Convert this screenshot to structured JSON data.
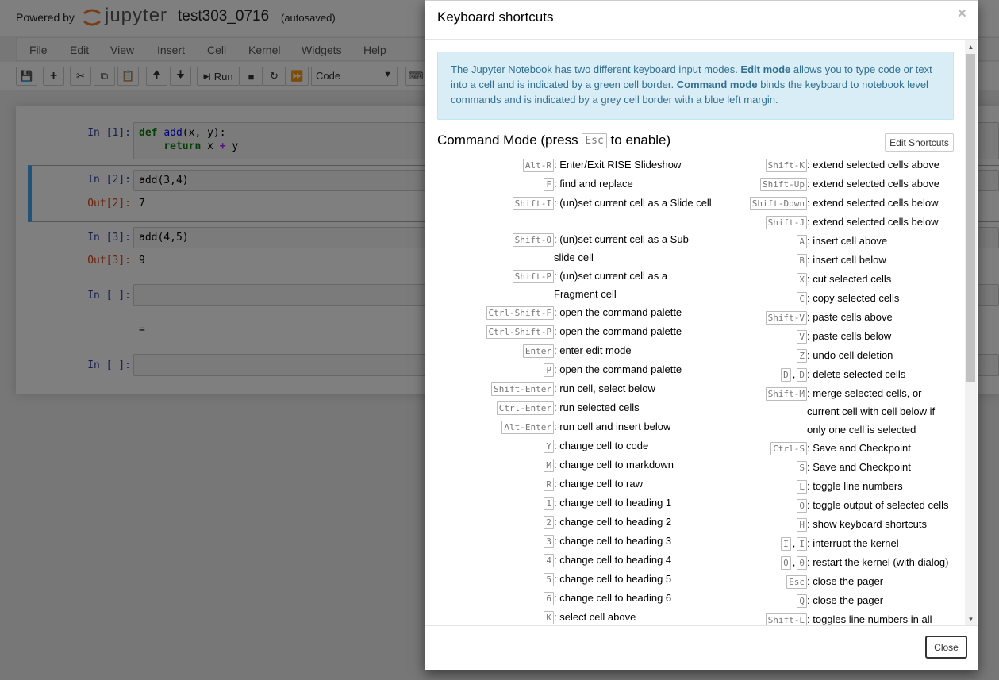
{
  "header": {
    "powered_by": "Powered by",
    "logo_text": "jupyter",
    "notebook_title": "test303_0716",
    "autosave_status": "(autosaved)"
  },
  "menu": [
    "File",
    "Edit",
    "View",
    "Insert",
    "Cell",
    "Kernel",
    "Widgets",
    "Help"
  ],
  "toolbar": {
    "run_label": "Run",
    "cell_type": "Code"
  },
  "cells": [
    {
      "in_prompt": "In [1]:",
      "line1_kw": "def",
      "line1_fn": "add",
      "line1_rest": "(x, y):",
      "line2_kw": "return",
      "line2_a": " x ",
      "line2_op": "+",
      "line2_b": " y"
    },
    {
      "in_prompt": "In [2]:",
      "code": "add(3,4)",
      "out_prompt": "Out[2]:",
      "output": "7"
    },
    {
      "in_prompt": "In [3]:",
      "code": "add(4,5)",
      "out_prompt": "Out[3]:",
      "output": "9"
    },
    {
      "in_prompt": "In [ ]:",
      "output": "="
    },
    {
      "in_prompt": "In [ ]:"
    }
  ],
  "modal": {
    "title": "Keyboard shortcuts",
    "close_x": "×",
    "info": {
      "t1": "The Jupyter Notebook has two different keyboard input modes. ",
      "b1": "Edit mode",
      "t2": " allows you to type code or text into a cell and is indicated by a green cell border. ",
      "b2": "Command mode",
      "t3": " binds the keyboard to notebook level commands and is indicated by a grey cell border with a blue left margin."
    },
    "section_pre": "Command Mode (press ",
    "section_key": "Esc",
    "section_post": " to enable)",
    "edit_shortcuts": "Edit Shortcuts",
    "close_button": "Close",
    "left_shortcuts": [
      {
        "keys": [
          "Alt-R"
        ],
        "desc": ": Enter/Exit RISE Slideshow"
      },
      {
        "keys": [
          "F"
        ],
        "desc": ": find and replace"
      },
      {
        "keys": [
          "Shift-I"
        ],
        "desc": ": (un)set current cell as a Slide cell"
      },
      {
        "keys": [
          "Shift-O"
        ],
        "desc": ": (un)set current cell as a Sub-slide cell"
      },
      {
        "keys": [
          "Shift-P"
        ],
        "desc": ": (un)set current cell as a Fragment cell"
      },
      {
        "keys": [
          "Ctrl-Shift-F"
        ],
        "desc": ": open the command palette"
      },
      {
        "keys": [
          "Ctrl-Shift-P"
        ],
        "desc": ": open the command palette"
      },
      {
        "keys": [
          "Enter"
        ],
        "desc": ": enter edit mode"
      },
      {
        "keys": [
          "P"
        ],
        "desc": ": open the command palette"
      },
      {
        "keys": [
          "Shift-Enter"
        ],
        "desc": ": run cell, select below"
      },
      {
        "keys": [
          "Ctrl-Enter"
        ],
        "desc": ": run selected cells"
      },
      {
        "keys": [
          "Alt-Enter"
        ],
        "desc": ": run cell and insert below"
      },
      {
        "keys": [
          "Y"
        ],
        "desc": ": change cell to code"
      },
      {
        "keys": [
          "M"
        ],
        "desc": ": change cell to markdown"
      },
      {
        "keys": [
          "R"
        ],
        "desc": ": change cell to raw"
      },
      {
        "keys": [
          "1"
        ],
        "desc": ": change cell to heading 1"
      },
      {
        "keys": [
          "2"
        ],
        "desc": ": change cell to heading 2"
      },
      {
        "keys": [
          "3"
        ],
        "desc": ": change cell to heading 3"
      },
      {
        "keys": [
          "4"
        ],
        "desc": ": change cell to heading 4"
      },
      {
        "keys": [
          "5"
        ],
        "desc": ": change cell to heading 5"
      },
      {
        "keys": [
          "6"
        ],
        "desc": ": change cell to heading 6"
      },
      {
        "keys": [
          "K"
        ],
        "desc": ": select cell above"
      }
    ],
    "right_shortcuts": [
      {
        "keys": [
          "Shift-K"
        ],
        "desc": ": extend selected cells above"
      },
      {
        "keys": [
          "Shift-Up"
        ],
        "desc": ": extend selected cells above"
      },
      {
        "keys": [
          "Shift-Down"
        ],
        "desc": ": extend selected cells below"
      },
      {
        "keys": [
          "Shift-J"
        ],
        "desc": ": extend selected cells below"
      },
      {
        "keys": [
          "A"
        ],
        "desc": ": insert cell above"
      },
      {
        "keys": [
          "B"
        ],
        "desc": ": insert cell below"
      },
      {
        "keys": [
          "X"
        ],
        "desc": ": cut selected cells"
      },
      {
        "keys": [
          "C"
        ],
        "desc": ": copy selected cells"
      },
      {
        "keys": [
          "Shift-V"
        ],
        "desc": ": paste cells above"
      },
      {
        "keys": [
          "V"
        ],
        "desc": ": paste cells below"
      },
      {
        "keys": [
          "Z"
        ],
        "desc": ": undo cell deletion"
      },
      {
        "keys": [
          "D",
          "D"
        ],
        "desc": ": delete selected cells"
      },
      {
        "keys": [
          "Shift-M"
        ],
        "desc": ": merge selected cells, or current cell with cell below if only one cell is selected"
      },
      {
        "keys": [
          "Ctrl-S"
        ],
        "desc": ": Save and Checkpoint"
      },
      {
        "keys": [
          "S"
        ],
        "desc": ": Save and Checkpoint"
      },
      {
        "keys": [
          "L"
        ],
        "desc": ": toggle line numbers"
      },
      {
        "keys": [
          "O"
        ],
        "desc": ": toggle output of selected cells"
      },
      {
        "keys": [
          "H"
        ],
        "desc": ": show keyboard shortcuts"
      },
      {
        "keys": [
          "I",
          "I"
        ],
        "desc": ": interrupt the kernel"
      },
      {
        "keys": [
          "0",
          "0"
        ],
        "desc": ": restart the kernel (with dialog)"
      },
      {
        "keys": [
          "Esc"
        ],
        "desc": ": close the pager"
      },
      {
        "keys": [
          "Q"
        ],
        "desc": ": close the pager"
      },
      {
        "keys": [
          "Shift-L"
        ],
        "desc": ": toggles line numbers in all cells"
      }
    ]
  }
}
